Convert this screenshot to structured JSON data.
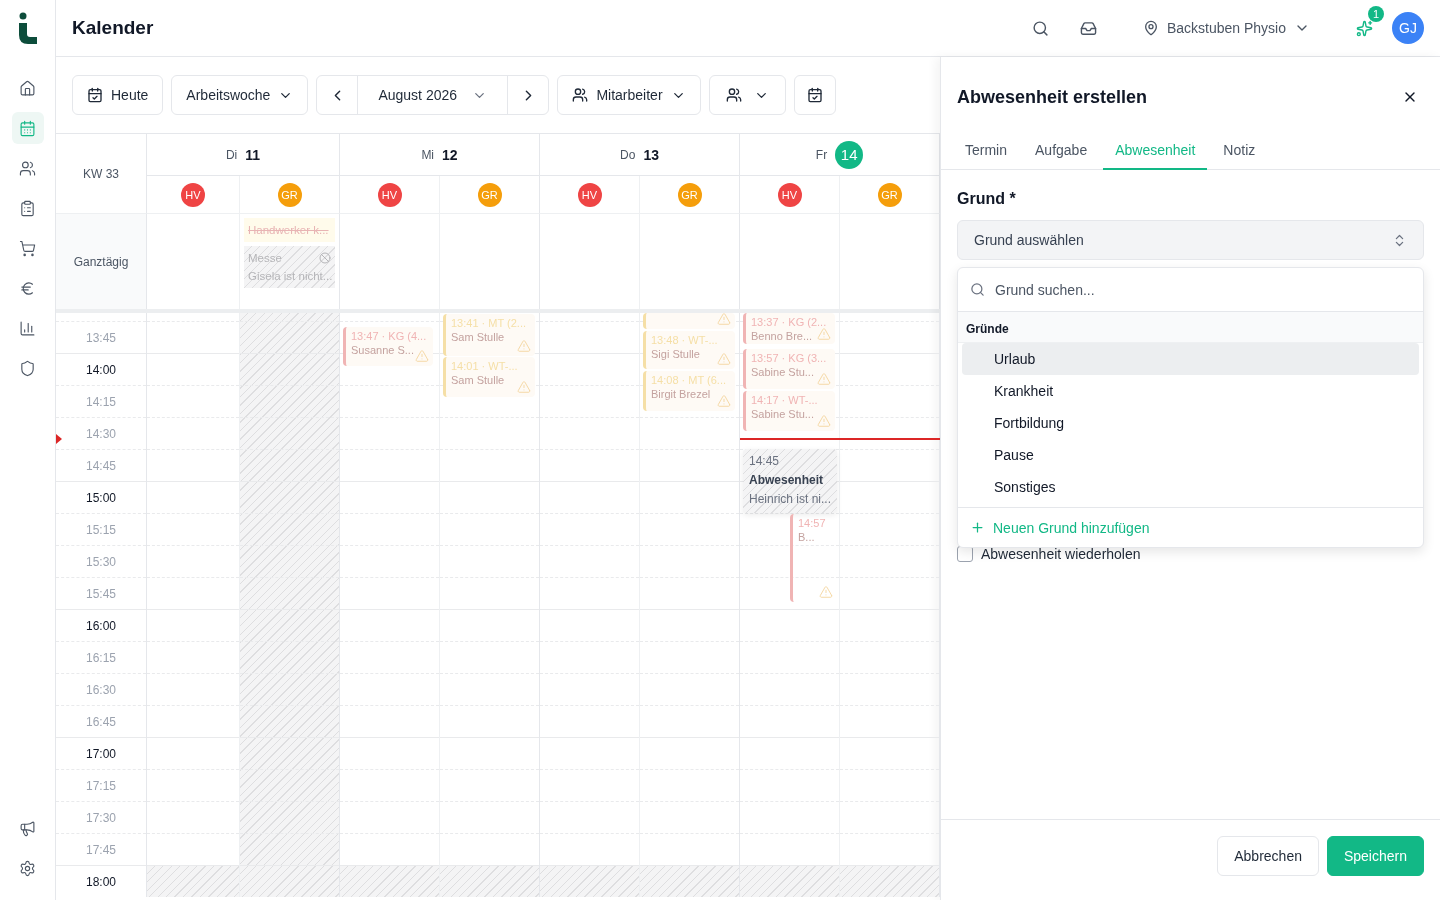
{
  "sidebar": {
    "items": [
      {
        "kind": "home",
        "selected": false
      },
      {
        "kind": "calendar",
        "selected": true
      },
      {
        "kind": "users",
        "selected": false
      },
      {
        "kind": "clipboard",
        "selected": false
      },
      {
        "kind": "cart",
        "selected": false
      },
      {
        "kind": "euro",
        "selected": false
      },
      {
        "kind": "chart",
        "selected": false
      },
      {
        "kind": "shield",
        "selected": false
      }
    ],
    "bottom_items": [
      {
        "kind": "megaphone",
        "selected": false
      },
      {
        "kind": "settings",
        "selected": false
      }
    ]
  },
  "header": {
    "title": "Kalender",
    "location": "Backstuben Physio",
    "notification_count": "1",
    "avatar": "GJ"
  },
  "toolbar": {
    "today": "Heute",
    "view": "Arbeitswoche",
    "month": "August 2026",
    "staff": "Mitarbeiter"
  },
  "calendar": {
    "week": "KW 33",
    "allday_label": "Ganztägig",
    "times": [
      {
        "label": "13:45",
        "full_hour": false,
        "now": false
      },
      {
        "label": "14:00",
        "full_hour": true,
        "now": false
      },
      {
        "label": "14:15",
        "full_hour": false,
        "now": false
      },
      {
        "label": "14:30",
        "full_hour": false,
        "now": true
      },
      {
        "label": "14:45",
        "full_hour": false,
        "now": false
      },
      {
        "label": "15:00",
        "full_hour": true,
        "now": false
      },
      {
        "label": "15:15",
        "full_hour": false,
        "now": false
      },
      {
        "label": "15:30",
        "full_hour": false,
        "now": false
      },
      {
        "label": "15:45",
        "full_hour": false,
        "now": false
      },
      {
        "label": "16:00",
        "full_hour": true,
        "now": false
      },
      {
        "label": "16:15",
        "full_hour": false,
        "now": false
      },
      {
        "label": "16:30",
        "full_hour": false,
        "now": false
      },
      {
        "label": "16:45",
        "full_hour": false,
        "now": false
      },
      {
        "label": "17:00",
        "full_hour": true,
        "now": false
      },
      {
        "label": "17:15",
        "full_hour": false,
        "now": false
      },
      {
        "label": "17:30",
        "full_hour": false,
        "now": false
      },
      {
        "label": "17:45",
        "full_hour": false,
        "now": false
      },
      {
        "label": "18:00",
        "full_hour": true,
        "now": false
      }
    ],
    "days": [
      {
        "weekday": "Di",
        "date": "11",
        "today": false,
        "staff": [
          {
            "initials": "HV",
            "color": "#ef4444",
            "absent": false
          },
          {
            "initials": "GR",
            "color": "#f59e0b",
            "absent": true,
            "allday": [
              {
                "kind": "cancelled",
                "title": "Handwerker k..."
              },
              {
                "kind": "absence",
                "title": "Messe",
                "note": "Gisela ist nicht..."
              }
            ]
          }
        ]
      },
      {
        "weekday": "Mi",
        "date": "12",
        "today": false,
        "staff": [
          {
            "initials": "HV",
            "color": "#ef4444",
            "absent": false,
            "events": [
              {
                "kind": "appointment",
                "time": "13:47 · KG (4...",
                "person": "Susanne S...",
                "color": "#f0b4b4",
                "warning": true
              }
            ]
          },
          {
            "initials": "GR",
            "color": "#f59e0b",
            "absent": false,
            "events": [
              {
                "kind": "appointment",
                "time": "13:41 · MT (2...",
                "person": "Sam Stulle",
                "color": "#f5dfa6",
                "warning": true
              },
              {
                "kind": "appointment",
                "time": "14:01 · WT-...",
                "person": "Sam Stulle",
                "color": "#f5dfa6",
                "warning": true
              }
            ]
          }
        ]
      },
      {
        "weekday": "Do",
        "date": "13",
        "today": false,
        "staff": [
          {
            "initials": "HV",
            "color": "#ef4444",
            "absent": false
          },
          {
            "initials": "GR",
            "color": "#f59e0b",
            "absent": false,
            "events": [
              {
                "kind": "appointment",
                "color": "#f5dfa6",
                "warning": true
              },
              {
                "kind": "appointment",
                "time": "13:48 · WT-...",
                "person": "Sigi Stulle",
                "color": "#f5dfa6",
                "warning": true
              },
              {
                "kind": "appointment",
                "time": "14:08 · MT (6...",
                "person": "Birgit Brezel",
                "color": "#f5dfa6",
                "warning": true
              }
            ]
          }
        ]
      },
      {
        "weekday": "Fr",
        "date": "14",
        "today": true,
        "staff": [
          {
            "initials": "HV",
            "color": "#ef4444",
            "absent": false,
            "events": [
              {
                "kind": "appointment",
                "time": "13:37 · KG (2...",
                "person": "Benno Bre...",
                "color": "#f0b4b4",
                "warning": true
              },
              {
                "kind": "appointment",
                "time": "13:57 · KG (3...",
                "person": "Sabine Stu...",
                "color": "#f0b4b4",
                "warning": true
              },
              {
                "kind": "appointment",
                "time": "14:17 · WT-...",
                "person": "Sabine Stu...",
                "color": "#f0b4b4",
                "warning": true
              },
              {
                "kind": "absence",
                "time": "14:45",
                "title": "Abwesenheit",
                "note": "Heinrich ist ni..."
              },
              {
                "kind": "appointment",
                "time": "14:57",
                "person": "B...",
                "color": "#f0b4b4",
                "warning": true
              }
            ]
          },
          {
            "initials": "GR",
            "color": "#f59e0b",
            "absent": false
          }
        ]
      }
    ]
  },
  "panel": {
    "title": "Abwesenheit erstellen",
    "tabs": [
      {
        "label": "Termin",
        "selected": false
      },
      {
        "label": "Aufgabe",
        "selected": false
      },
      {
        "label": "Abwesenheit",
        "selected": true
      },
      {
        "label": "Notiz",
        "selected": false
      }
    ],
    "reason_label": "Grund *",
    "reason_placeholder": "Grund auswählen",
    "dropdown": {
      "search_placeholder": "Grund suchen...",
      "group": "Gründe",
      "options": [
        {
          "label": "Urlaub",
          "selected": true
        },
        {
          "label": "Krankheit",
          "selected": false
        },
        {
          "label": "Fortbildung",
          "selected": false
        },
        {
          "label": "Pause",
          "selected": false
        },
        {
          "label": "Sonstiges",
          "selected": false
        }
      ],
      "add_label": "Neuen Grund hinzufügen"
    },
    "repeat": {
      "label": "Abwesenheit wiederholen",
      "checked": false
    },
    "buttons": [
      {
        "label": "Abbrechen",
        "kind": "secondary"
      },
      {
        "label": "Speichern",
        "kind": "primary"
      }
    ]
  }
}
